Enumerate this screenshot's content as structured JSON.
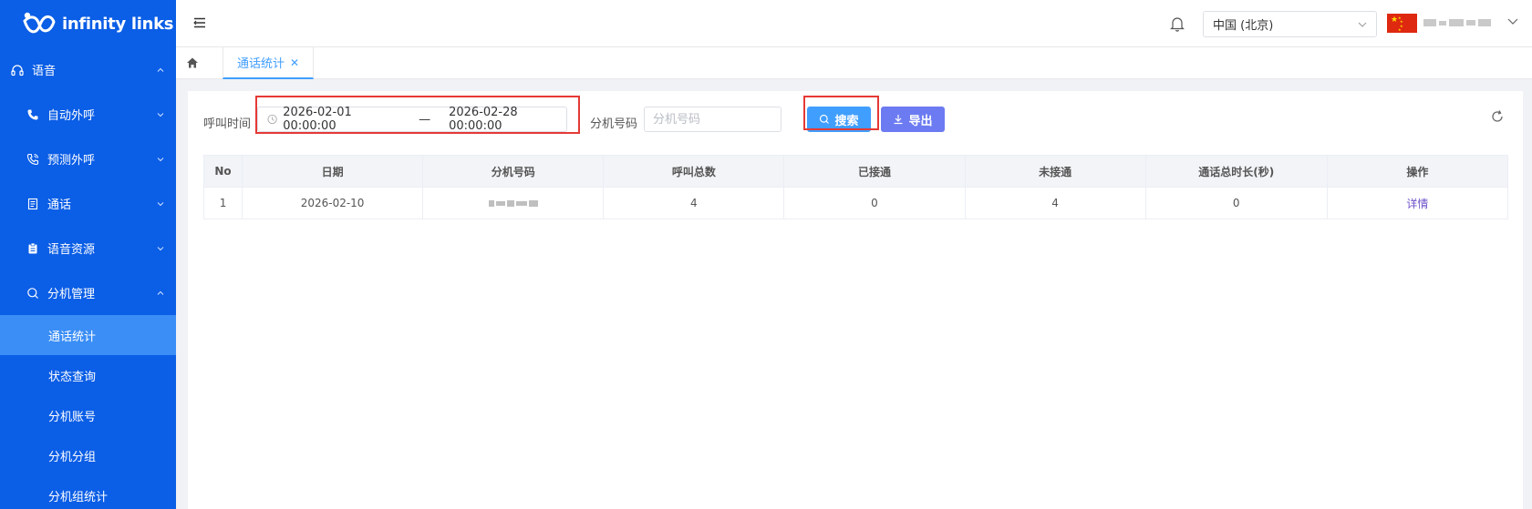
{
  "brand": {
    "name": "infinity links"
  },
  "sidebar": {
    "items": [
      {
        "label": "语音",
        "icon": "headset-icon",
        "expanded": true
      },
      {
        "label": "自动外呼",
        "icon": "phone-icon",
        "expanded": false
      },
      {
        "label": "预测外呼",
        "icon": "phone-forward-icon",
        "expanded": false
      },
      {
        "label": "通话",
        "icon": "document-icon",
        "expanded": false
      },
      {
        "label": "语音资源",
        "icon": "clipboard-icon",
        "expanded": false
      },
      {
        "label": "分机管理",
        "icon": "search-icon",
        "expanded": true
      }
    ],
    "sub_items": [
      {
        "label": "通话统计",
        "active": true
      },
      {
        "label": "状态查询",
        "active": false
      },
      {
        "label": "分机账号",
        "active": false
      },
      {
        "label": "分机分组",
        "active": false
      },
      {
        "label": "分机组统计",
        "active": false
      }
    ],
    "active_color": "#3a8ef6",
    "background": "#0b5ee6"
  },
  "header": {
    "region": "中国 (北京)"
  },
  "tabs": {
    "active": {
      "label": "通话统计",
      "close": "✕"
    }
  },
  "filters": {
    "call_time_label": "呼叫时间",
    "start_date": "2026-02-01 00:00:00",
    "separator": "—",
    "end_date": "2026-02-28 00:00:00",
    "extension_label": "分机号码",
    "extension_placeholder": "分机号码",
    "search_label": "搜索",
    "export_label": "导出"
  },
  "table": {
    "columns": [
      "No",
      "日期",
      "分机号码",
      "呼叫总数",
      "已接通",
      "未接通",
      "通话总时长(秒)",
      "操作"
    ],
    "rows": [
      {
        "no": "1",
        "date": "2026-02-10",
        "total": "4",
        "connected": "0",
        "missed": "4",
        "duration": "0",
        "action": "详情"
      }
    ]
  },
  "colors": {
    "primary": "#409eff",
    "export": "#6c7bf1",
    "highlight": "#e53935",
    "link": "#6c4fc9"
  }
}
